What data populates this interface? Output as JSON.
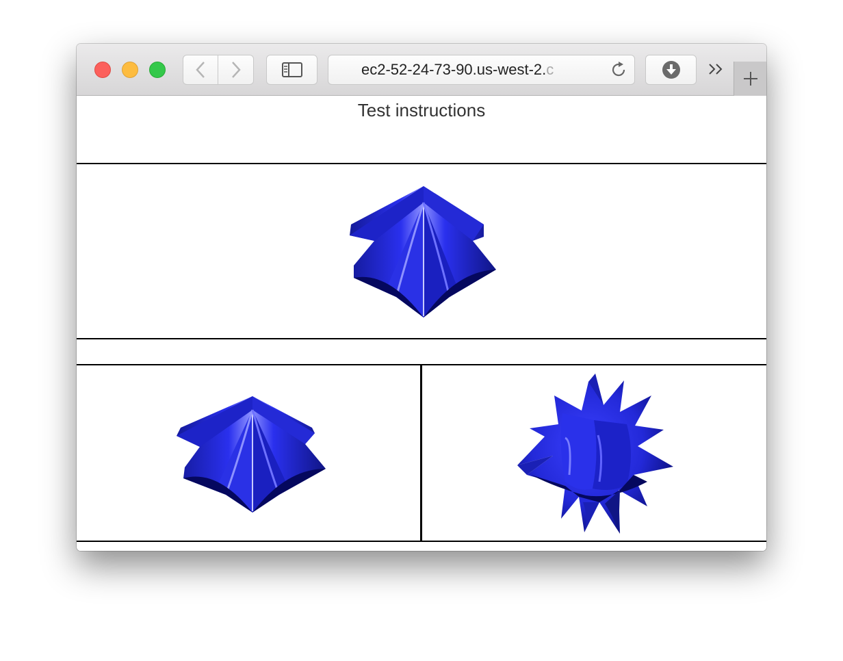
{
  "browser": {
    "address_text": "ec2-52-24-73-90.us-west-2.",
    "address_fade": "c",
    "icons": [
      "back-chevron-icon",
      "forward-chevron-icon",
      "sidebar-icon",
      "reload-icon",
      "download-icon",
      "more-icon",
      "plus-icon"
    ]
  },
  "page": {
    "heading": "Test instructions"
  },
  "colors": {
    "shape_blue": "#1c22d6",
    "shape_dark": "#05085e",
    "shape_highlight": "#8e92ff"
  },
  "stimuli": {
    "target": "folded-star-shape",
    "option_left": "folded-star-shape",
    "option_right": "spiky-star-shape"
  }
}
